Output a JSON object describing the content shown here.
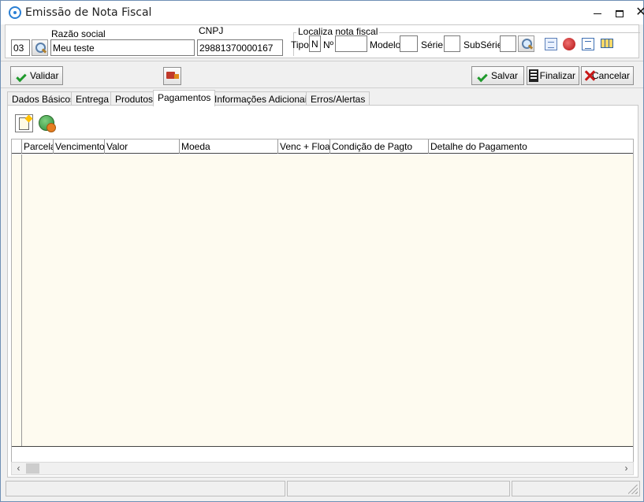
{
  "window": {
    "title": "Emissão de Nota Fiscal"
  },
  "header": {
    "code_value": "03",
    "razao_label": "Razão social",
    "razao_value": "Meu teste",
    "cnpj_label": "CNPJ",
    "cnpj_value": "29881370000167",
    "localiza_title": "Localiza nota fiscal",
    "tipo_label": "Tipo",
    "tipo_value": "N",
    "numero_label": "Nº",
    "numero_value": "",
    "modelo_label": "Modelo",
    "modelo_value": "",
    "serie_label": "Série",
    "serie_value": "",
    "subserie_label": "SubSérie",
    "subserie_value": ""
  },
  "toolbar": {
    "validar_label": "Validar",
    "salvar_label": "Salvar",
    "finalizar_label": "Finalizar",
    "cancelar_label": "Cancelar"
  },
  "tabs": [
    {
      "label": "Dados Básicos",
      "active": false
    },
    {
      "label": "Entrega",
      "active": false
    },
    {
      "label": "Produtos",
      "active": false
    },
    {
      "label": "Pagamentos",
      "active": true
    },
    {
      "label": "Informações Adicionais",
      "active": false
    },
    {
      "label": "Erros/Alertas",
      "active": false
    }
  ],
  "payments_grid": {
    "columns": [
      "Parcela",
      "Vencimento",
      "Valor",
      "Moeda",
      "Venc + Float",
      "Condição de Pagto",
      "Detalhe do Pagamento"
    ],
    "rows": []
  },
  "icons": {
    "app": "app-icon",
    "search": "magnifier-icon",
    "truck": "truck-icon",
    "new_payment": "new-document-icon",
    "globe": "globe-icon"
  },
  "colors": {
    "grid_body": "#fefbf0",
    "accent_green": "#1f9a2c",
    "accent_red": "#c81818"
  }
}
